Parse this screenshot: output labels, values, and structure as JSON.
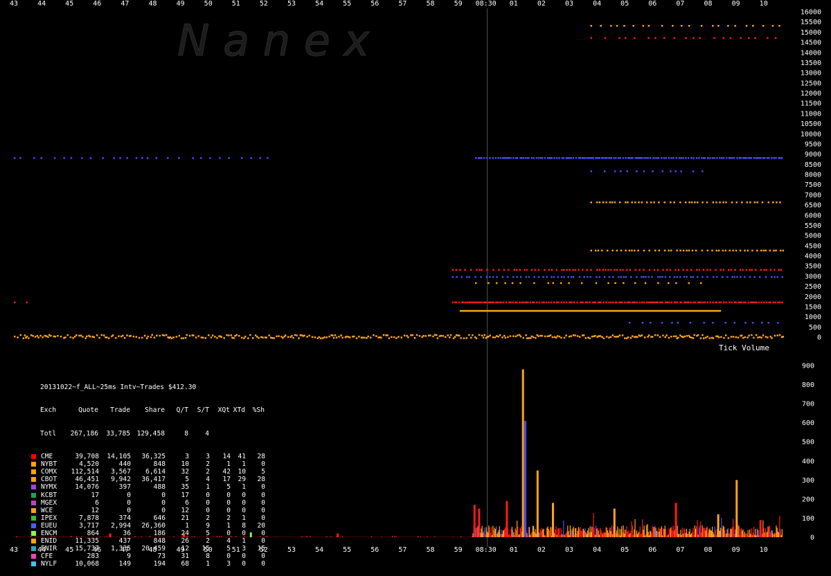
{
  "chart_data": [
    {
      "type": "scatter",
      "title": "",
      "watermark": "N a n e x",
      "x_ticks": [
        "43",
        "44",
        "45",
        "46",
        "47",
        "48",
        "49",
        "50",
        "51",
        "52",
        "53",
        "54",
        "55",
        "56",
        "57",
        "58",
        "59",
        "08:30",
        "01",
        "02",
        "03",
        "04",
        "05",
        "06",
        "07",
        "08",
        "09",
        "10"
      ],
      "marker_label": "08:30",
      "y_ticks": [
        "16000",
        "15500",
        "15000",
        "14500",
        "14000",
        "13500",
        "13000",
        "12500",
        "12000",
        "11500",
        "11000",
        "10500",
        "10000",
        "9500",
        "9000",
        "8500",
        "8000",
        "7500",
        "7000",
        "6500",
        "6000",
        "5500",
        "5000",
        "4500",
        "4000",
        "3500",
        "3000",
        "2500",
        "2000",
        "1500",
        "1000",
        "500",
        "0"
      ],
      "ylim": [
        0,
        16000
      ],
      "grid": false,
      "bands": [
        {
          "series": "COMX",
          "y": 15300,
          "from": 0.75,
          "to": 1.0,
          "density": "sparse"
        },
        {
          "series": "CME",
          "y": 14700,
          "from": 0.75,
          "to": 1.0,
          "density": "sparse"
        },
        {
          "series": "NYMX",
          "y": 8800,
          "from": 0.0,
          "to": 0.33,
          "density": "sparse"
        },
        {
          "series": "NYMX",
          "y": 8800,
          "from": 0.6,
          "to": 1.0,
          "density": "dense"
        },
        {
          "series": "NYMX",
          "y": 8150,
          "from": 0.75,
          "to": 0.9,
          "density": "sparse"
        },
        {
          "series": "COMX",
          "y": 6620,
          "from": 0.75,
          "to": 1.0,
          "density": "medium"
        },
        {
          "series": "COMX",
          "y": 4250,
          "from": 0.75,
          "to": 1.0,
          "density": "medium"
        },
        {
          "series": "CME",
          "y": 3300,
          "from": 0.57,
          "to": 1.0,
          "density": "medium"
        },
        {
          "series": "NYMX",
          "y": 2950,
          "from": 0.57,
          "to": 1.0,
          "density": "medium"
        },
        {
          "series": "COMX",
          "y": 2650,
          "from": 0.6,
          "to": 0.9,
          "density": "sparse"
        },
        {
          "series": "CME",
          "y": 1700,
          "from": 0.0,
          "to": 0.03,
          "density": "sparse"
        },
        {
          "series": "CME",
          "y": 1700,
          "from": 0.57,
          "to": 1.0,
          "density": "dense"
        },
        {
          "series": "COMX",
          "y": 1300,
          "from": 0.58,
          "to": 0.92,
          "density": "line"
        },
        {
          "series": "NYMX",
          "y": 700,
          "from": 0.8,
          "to": 1.0,
          "density": "sparse"
        },
        {
          "series": "COMX",
          "y": 0,
          "from": 0.0,
          "to": 1.0,
          "density": "dense"
        }
      ]
    },
    {
      "type": "bar",
      "title": "Tick Volume",
      "y_ticks": [
        "900",
        "800",
        "700",
        "600",
        "500",
        "400",
        "300",
        "200",
        "100",
        "0"
      ],
      "ylim": [
        0,
        900
      ],
      "spikes": [
        {
          "pos": 0.0,
          "value": 0,
          "series": "COMX"
        },
        {
          "pos": 0.124,
          "value": 20,
          "series": "CME"
        },
        {
          "pos": 0.22,
          "value": 20,
          "series": "CME"
        },
        {
          "pos": 0.307,
          "value": 25,
          "series": "ENCM"
        },
        {
          "pos": 0.42,
          "value": 20,
          "series": "CME"
        },
        {
          "pos": 0.598,
          "value": 170,
          "series": "CME"
        },
        {
          "pos": 0.604,
          "value": 150,
          "series": "CME"
        },
        {
          "pos": 0.64,
          "value": 190,
          "series": "CME"
        },
        {
          "pos": 0.661,
          "value": 880,
          "series": "COMX"
        },
        {
          "pos": 0.664,
          "value": 610,
          "series": "NYMX"
        },
        {
          "pos": 0.68,
          "value": 350,
          "series": "COMX"
        },
        {
          "pos": 0.7,
          "value": 180,
          "series": "COMX"
        },
        {
          "pos": 0.78,
          "value": 150,
          "series": "COMX"
        },
        {
          "pos": 0.86,
          "value": 180,
          "series": "CME"
        },
        {
          "pos": 0.915,
          "value": 120,
          "series": "COMX"
        },
        {
          "pos": 0.939,
          "value": 300,
          "series": "COMX"
        },
        {
          "pos": 0.97,
          "value": 90,
          "series": "CME"
        }
      ]
    }
  ],
  "stats": {
    "title": "20131022~f_ALL~25ms Intv~Trades $412.30",
    "headers": [
      "Exch",
      "Quote",
      "Trade",
      "Share",
      "Q/T",
      "S/T",
      "XQt",
      "XTd",
      "%Sh"
    ],
    "total": [
      "Totl",
      "267,186",
      "33,785",
      "129,458",
      "8",
      "4",
      "",
      "",
      ""
    ],
    "rows": [
      {
        "c": "#ff0000",
        "v": [
          "CME",
          "39,708",
          "14,105",
          "36,325",
          "3",
          "3",
          "14",
          "41",
          "28"
        ]
      },
      {
        "c": "#ffa500",
        "v": [
          "NYBT",
          "4,520",
          "440",
          "848",
          "10",
          "2",
          "1",
          "1",
          "0"
        ]
      },
      {
        "c": "#ffa500",
        "v": [
          "COMX",
          "112,514",
          "3,567",
          "6,614",
          "32",
          "2",
          "42",
          "10",
          "5"
        ]
      },
      {
        "c": "#ffa500",
        "v": [
          "CBOT",
          "46,451",
          "9,942",
          "36,417",
          "5",
          "4",
          "17",
          "29",
          "28"
        ]
      },
      {
        "c": "#a040ff",
        "v": [
          "NYMX",
          "14,076",
          "397",
          "488",
          "35",
          "1",
          "5",
          "1",
          "0"
        ]
      },
      {
        "c": "#20a060",
        "v": [
          "KCBT",
          "17",
          "0",
          "0",
          "17",
          "0",
          "0",
          "0",
          "0"
        ]
      },
      {
        "c": "#c040c0",
        "v": [
          "MGEX",
          "6",
          "0",
          "0",
          "6",
          "0",
          "0",
          "0",
          "0"
        ]
      },
      {
        "c": "#ffa500",
        "v": [
          "WCE",
          "12",
          "0",
          "0",
          "12",
          "0",
          "0",
          "0",
          "0"
        ]
      },
      {
        "c": "#30c030",
        "v": [
          "IPEX",
          "7,878",
          "374",
          "646",
          "21",
          "2",
          "2",
          "1",
          "0"
        ]
      },
      {
        "c": "#4060ff",
        "v": [
          "EUEU",
          "3,717",
          "2,994",
          "26,360",
          "1",
          "9",
          "1",
          "8",
          "20"
        ]
      },
      {
        "c": "#80ff40",
        "v": [
          "ENCM",
          "864",
          "36",
          "186",
          "24",
          "5",
          "0",
          "0",
          "0"
        ]
      },
      {
        "c": "#ffa500",
        "v": [
          "ENID",
          "11,335",
          "437",
          "848",
          "26",
          "2",
          "4",
          "1",
          "0"
        ]
      },
      {
        "c": "#30a0c0",
        "v": [
          "ENIR",
          "15,737",
          "1,335",
          "20,459",
          "12",
          "15",
          "5",
          "3",
          "15"
        ]
      },
      {
        "c": "#ff40c0",
        "v": [
          "CFE",
          "283",
          "9",
          "73",
          "31",
          "8",
          "0",
          "0",
          "0"
        ]
      },
      {
        "c": "#40c0ff",
        "v": [
          "NYLF",
          "10,068",
          "149",
          "194",
          "68",
          "1",
          "3",
          "0",
          "0"
        ]
      }
    ]
  },
  "colors": {
    "CME": "#ff1a1a",
    "COMX": "#ffa31a",
    "NYMX": "#4a4aff",
    "IPEX": "#30c030",
    "ENCM": "#80ff40",
    "axis": "#888888",
    "background": "#000000"
  }
}
